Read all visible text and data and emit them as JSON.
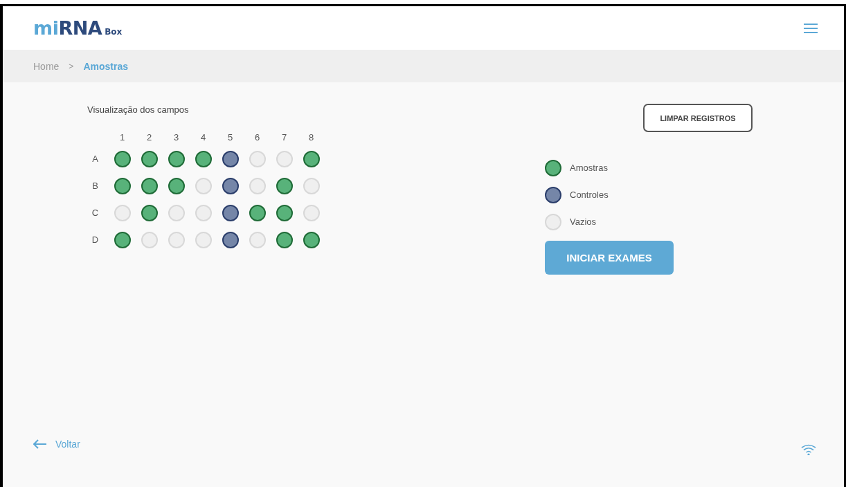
{
  "header": {
    "logo": [
      {
        "text": "mi",
        "kind": "light"
      },
      {
        "text": "RNA",
        "kind": "dark"
      }
    ],
    "logo_suffix": "Box"
  },
  "breadcrumb": [
    {
      "label": "Home",
      "selected": false
    },
    {
      "label": "Amostras",
      "selected": true
    }
  ],
  "breadcrumb_separator": ">",
  "plate": {
    "title": "Visualização dos campos",
    "columns": [
      "1",
      "2",
      "3",
      "4",
      "5",
      "6",
      "7",
      "8"
    ],
    "rows": [
      {
        "label": "A",
        "wells": [
          {
            "kind": "sample"
          },
          {
            "kind": "sample"
          },
          {
            "kind": "sample"
          },
          {
            "kind": "sample"
          },
          {
            "kind": "control"
          },
          {
            "kind": "empty"
          },
          {
            "kind": "empty"
          },
          {
            "kind": "sample"
          }
        ]
      },
      {
        "label": "B",
        "wells": [
          {
            "kind": "sample"
          },
          {
            "kind": "sample"
          },
          {
            "kind": "sample"
          },
          {
            "kind": "empty"
          },
          {
            "kind": "control"
          },
          {
            "kind": "empty"
          },
          {
            "kind": "sample"
          },
          {
            "kind": "empty"
          }
        ]
      },
      {
        "label": "C",
        "wells": [
          {
            "kind": "empty"
          },
          {
            "kind": "sample"
          },
          {
            "kind": "empty"
          },
          {
            "kind": "empty"
          },
          {
            "kind": "control"
          },
          {
            "kind": "sample"
          },
          {
            "kind": "sample"
          },
          {
            "kind": "empty"
          }
        ]
      },
      {
        "label": "D",
        "wells": [
          {
            "kind": "sample"
          },
          {
            "kind": "empty"
          },
          {
            "kind": "empty"
          },
          {
            "kind": "empty"
          },
          {
            "kind": "control"
          },
          {
            "kind": "empty"
          },
          {
            "kind": "sample"
          },
          {
            "kind": "sample"
          }
        ]
      }
    ]
  },
  "clear_button": "LIMPAR REGISTROS",
  "legend": [
    {
      "kind": "sample",
      "label": "Amostras"
    },
    {
      "kind": "control",
      "label": "Controles"
    },
    {
      "kind": "empty",
      "label": "Vazios"
    }
  ],
  "start_button": "INICIAR EXAMES",
  "footer": {
    "back": "Voltar"
  }
}
